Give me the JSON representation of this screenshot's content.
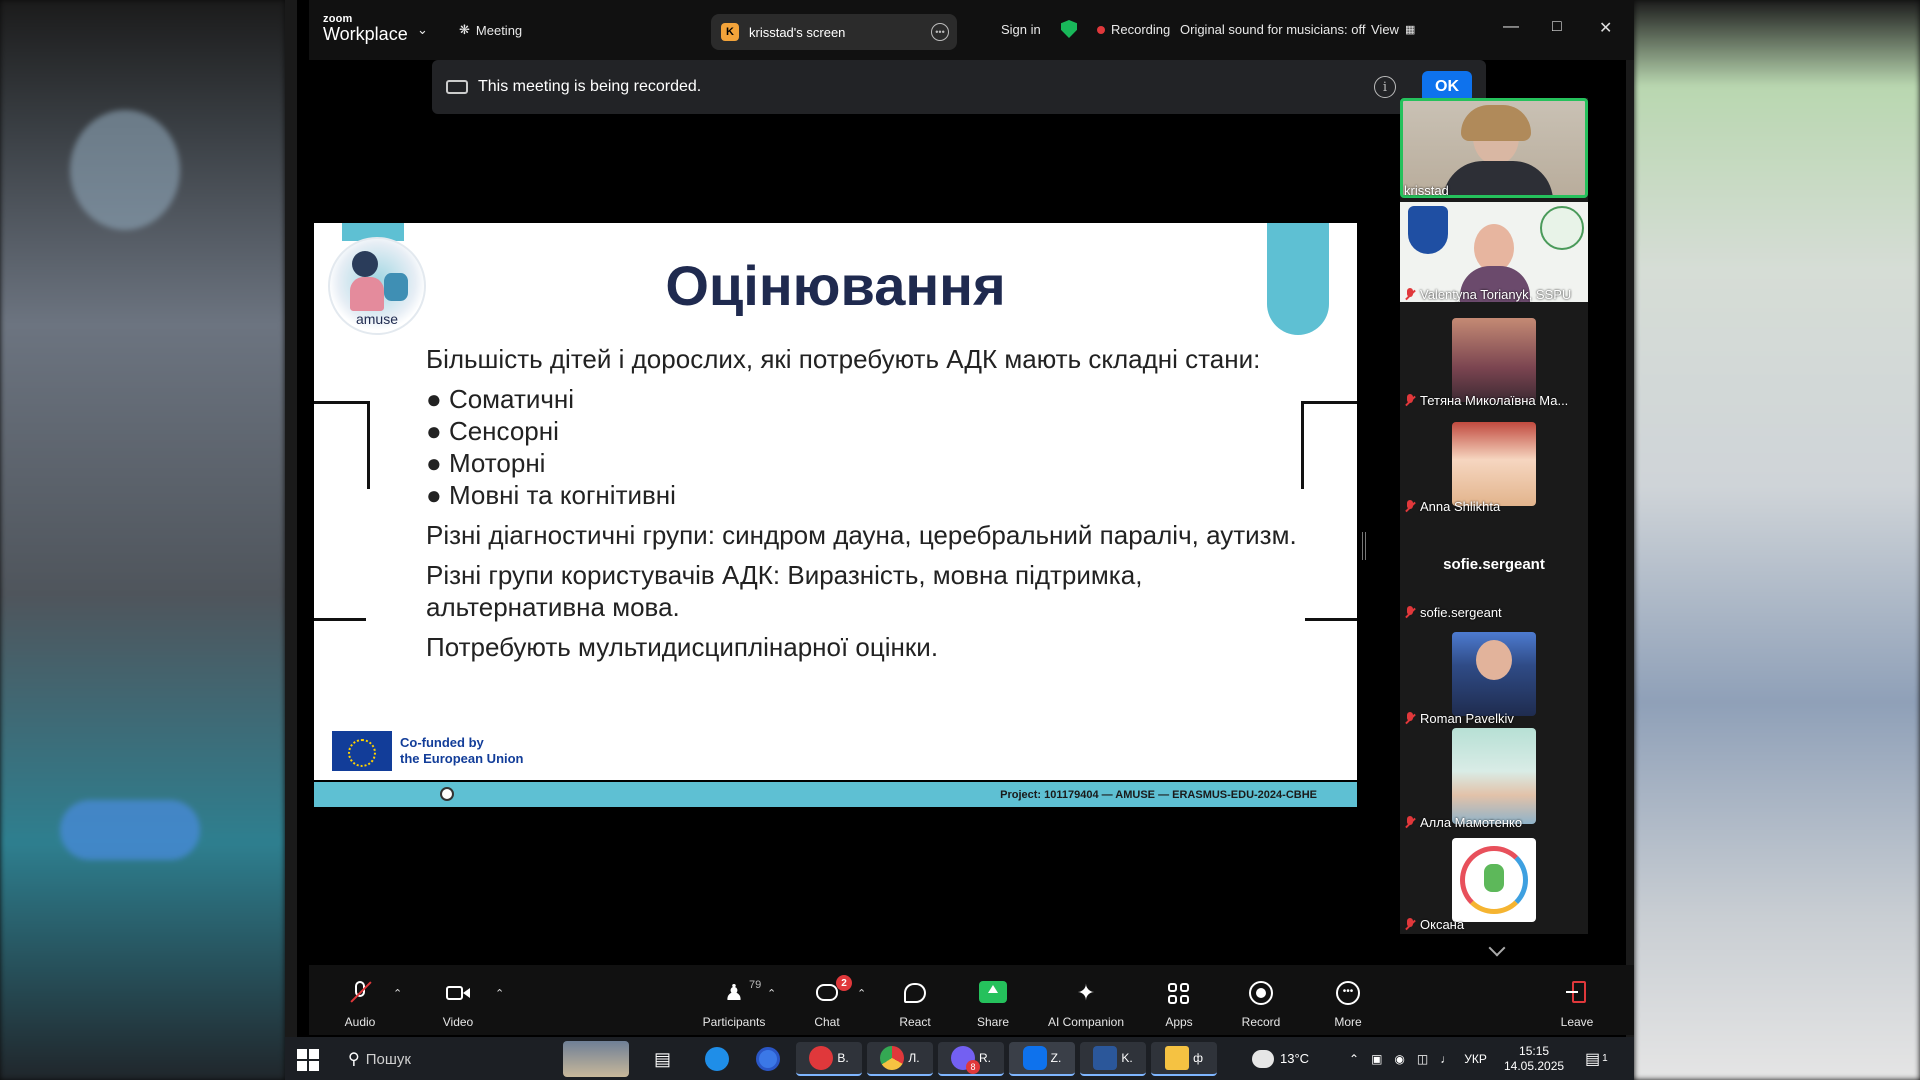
{
  "titlebar": {
    "brand_small": "zoom",
    "brand_big": "Workplace",
    "meeting_label": "Meeting",
    "screen_badge": "K",
    "screen_label": "krisstad's screen",
    "sign_in": "Sign in",
    "recording_label": "Recording",
    "original_sound": "Original sound for musicians: off",
    "view_label": "View"
  },
  "banner": {
    "message": "This meeting is being recorded.",
    "info_glyph": "i",
    "ok_label": "OK"
  },
  "slide": {
    "logo_text": "amuse",
    "title": "Оцінювання",
    "intro": "Більшість дітей і дорослих, які потребують АДК мають складні стани:",
    "bullets": [
      "Соматичні",
      "Сенсорні",
      "Моторні",
      "Мовні та когнітивні"
    ],
    "para1": "Різні діагностичні групи: синдром дауна, церебральний параліч, аутизм.",
    "para2": "Різні групи користувачів АДК: Виразність, мовна підтримка, альтернативна мова.",
    "para3": "Потребують мультидисциплінарної оцінки.",
    "eu_line1": "Co-funded by",
    "eu_line2": "the European Union",
    "project": "Project: 101179404 — AMUSE — ERASMUS-EDU-2024-CBHE"
  },
  "participants": [
    {
      "name": "krisstad",
      "muted": false,
      "active": true
    },
    {
      "name": "Valentyna Torianyk, SSPU",
      "muted": true
    },
    {
      "name": "Тетяна Миколаївна Ма...",
      "muted": true
    },
    {
      "name": "Anna Shlikhta",
      "muted": true
    },
    {
      "name": "sofie.sergeant",
      "muted": true,
      "title": "sofie.sergeant"
    },
    {
      "name": "Roman Pavelkiv",
      "muted": true
    },
    {
      "name": "Алла Мамотенко",
      "muted": true
    },
    {
      "name": "Оксана",
      "muted": true
    }
  ],
  "toolbar": {
    "audio": "Audio",
    "video": "Video",
    "participants": "Participants",
    "participants_count": "79",
    "chat": "Chat",
    "chat_badge": "2",
    "react": "React",
    "share": "Share",
    "ai_companion": "AI Companion",
    "apps": "Apps",
    "record": "Record",
    "more": "More",
    "leave": "Leave"
  },
  "taskbar": {
    "search_placeholder": "Пошук",
    "apps": [
      {
        "label": "B.",
        "color": "#e0383b"
      },
      {
        "label": "Л.",
        "color": "#34a853"
      },
      {
        "label": "R.",
        "color": "#7360f2"
      },
      {
        "label": "Z.",
        "color": "#0e72ed"
      },
      {
        "label": "K.",
        "color": "#2b579a"
      },
      {
        "label": "ф",
        "color": "#f5c242"
      }
    ],
    "viber_badge": "8",
    "weather": "13°C",
    "language": "УКР",
    "time": "15:15",
    "date": "14.05.2025",
    "notifications": "1"
  },
  "colors": {
    "accent_blue": "#0e72ed",
    "slide_teal": "#5ec0d3",
    "title_navy": "#1f2a4f",
    "active_speaker": "#25c15c",
    "mute_red": "#e0383b"
  }
}
